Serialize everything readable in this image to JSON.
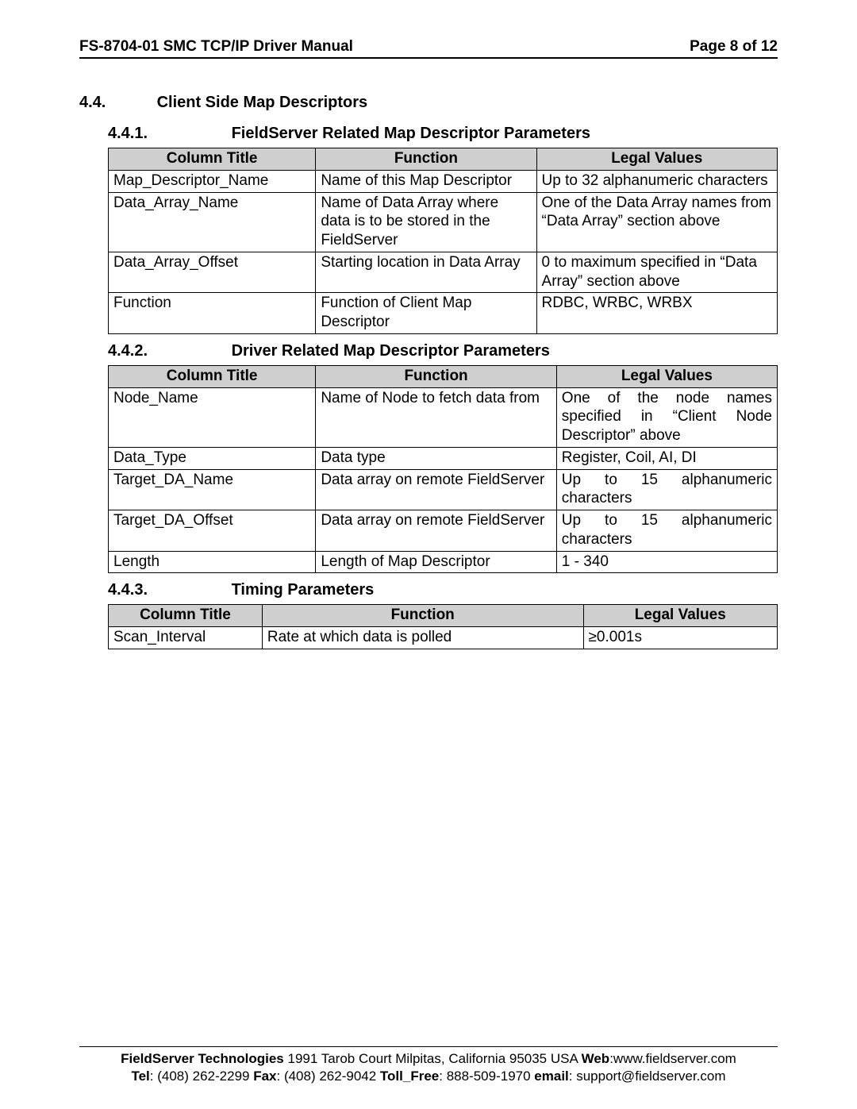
{
  "header": {
    "left": "FS-8704-01 SMC TCP/IP Driver Manual",
    "right": "Page 8 of 12"
  },
  "section": {
    "num": "4.4.",
    "title": "Client Side Map Descriptors"
  },
  "sub1": {
    "num": "4.4.1.",
    "title": "FieldServer Related Map Descriptor Parameters",
    "headers": {
      "c1": "Column Title",
      "c2": "Function",
      "c3": "Legal Values"
    },
    "rows": [
      {
        "c1": "Map_Descriptor_Name",
        "c2": "Name of this Map Descriptor",
        "c3": "Up to 32 alphanumeric characters"
      },
      {
        "c1": "Data_Array_Name",
        "c2": "Name of Data Array where data is to be stored in the FieldServer",
        "c3": "One of the Data Array names from “Data Array” section above"
      },
      {
        "c1": "Data_Array_Offset",
        "c2": "Starting location in Data Array",
        "c3": "0 to maximum specified in “Data Array” section above"
      },
      {
        "c1": "Function",
        "c2": "Function of Client Map Descriptor",
        "c3": "RDBC, WRBC, WRBX"
      }
    ]
  },
  "sub2": {
    "num": "4.4.2.",
    "title": "Driver Related Map Descriptor Parameters",
    "headers": {
      "c1": "Column Title",
      "c2": "Function",
      "c3": "Legal Values"
    },
    "rows": [
      {
        "c1": "Node_Name",
        "c2": "Name of Node to fetch data from",
        "c3": "One of the node names specified in “Client Node Descriptor” above"
      },
      {
        "c1": "Data_Type",
        "c2": "Data type",
        "c3": "Register, Coil, AI, DI"
      },
      {
        "c1": "Target_DA_Name",
        "c2": "Data array on remote FieldServer",
        "c3": "Up to 15 alphanumeric characters"
      },
      {
        "c1": "Target_DA_Offset",
        "c2": "Data array on remote FieldServer",
        "c3": "Up to 15 alphanumeric characters"
      },
      {
        "c1": "Length",
        "c2": "Length of Map Descriptor",
        "c3": "1 - 340"
      }
    ]
  },
  "sub3": {
    "num": "4.4.3.",
    "title": "Timing Parameters",
    "headers": {
      "c1": "Column Title",
      "c2": "Function",
      "c3": "Legal Values"
    },
    "rows": [
      {
        "c1": "Scan_Interval",
        "c2": "Rate at which data is polled",
        "c3": "≥0.001s"
      }
    ]
  },
  "footer": {
    "l1a": "FieldServer Technologies",
    "l1b": " 1991 Tarob Court Milpitas, California 95035 USA  ",
    "l1c": "Web",
    "l1d": ":www.fieldserver.com",
    "l2a": "Tel",
    "l2b": ": (408) 262-2299   ",
    "l2c": "Fax",
    "l2d": ": (408) 262-9042   ",
    "l2e": "Toll_Free",
    "l2f": ": 888-509-1970   ",
    "l2g": "email",
    "l2h": ": support@fieldserver.com"
  }
}
